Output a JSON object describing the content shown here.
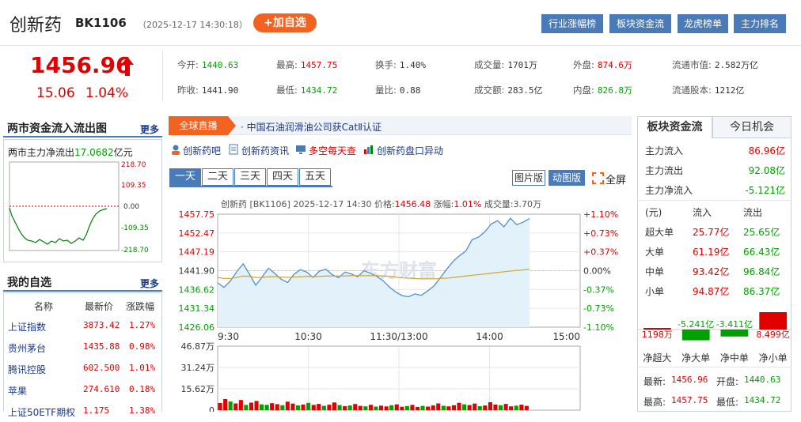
{
  "header": {
    "title": "创新药",
    "code": "BK1106",
    "datetime": "（2025-12-17 14:30:18）",
    "add_label": "+加自选",
    "nav": [
      "行业涨幅榜",
      "板块资金流",
      "龙虎榜单",
      "主力排名"
    ]
  },
  "quote": {
    "price": "1456.96",
    "change": "15.06",
    "change_pct": "1.04%",
    "items": [
      {
        "label": "今开:",
        "value": "1440.63",
        "color": "#00a000"
      },
      {
        "label": "最高:",
        "value": "1457.75",
        "color": "#e10000"
      },
      {
        "label": "换手:",
        "value": "1.40%",
        "color": "#333333"
      },
      {
        "label": "成交量:",
        "value": "1701万",
        "color": "#333333"
      },
      {
        "label": "外盘:",
        "value": "874.6万",
        "color": "#e10000"
      },
      {
        "label": "流通市值:",
        "value": "2.582万亿",
        "color": "#333333"
      },
      {
        "label": "昨收:",
        "value": "1441.90",
        "color": "#333333"
      },
      {
        "label": "最低:",
        "value": "1434.72",
        "color": "#00a000"
      },
      {
        "label": "量比:",
        "value": "0.88",
        "color": "#333333"
      },
      {
        "label": "成交额:",
        "value": "283.5亿",
        "color": "#333333"
      },
      {
        "label": "内盘:",
        "value": "826.8万",
        "color": "#00a000"
      },
      {
        "label": "流通股本:",
        "value": "1212亿",
        "color": "#333333"
      }
    ]
  },
  "flow_panel": {
    "title": "两市资金流入流出图",
    "more": "更多",
    "caption_prefix": "两市主力净流出",
    "caption_value": "17.0682",
    "caption_unit": "亿元",
    "ticks": [
      "218.70",
      "109.35",
      "0.00",
      "-109.35",
      "-218.70"
    ]
  },
  "watchlist": {
    "title": "我的自选",
    "more": "更多",
    "headers": [
      "名称",
      "最新价",
      "涨跌幅"
    ],
    "rows": [
      {
        "name": "上证指数",
        "price": "3873.42",
        "pct": "1.27%"
      },
      {
        "name": "贵州茅台",
        "price": "1435.88",
        "pct": "0.98%"
      },
      {
        "name": "腾讯控股",
        "price": "602.500",
        "pct": "1.01%"
      },
      {
        "name": "苹果",
        "price": "274.610",
        "pct": "0.18%"
      },
      {
        "name": "上证50ETF期权",
        "price": "1.175",
        "pct": "1.38%"
      }
    ]
  },
  "news": {
    "badge": "全球直播",
    "headline": "· 中国石油润滑油公司获CatⅡ认证"
  },
  "links": [
    "创新药吧",
    "创新药资讯",
    "多空每天查",
    "创新药盘口异动"
  ],
  "period_tabs": [
    "一天",
    "二天",
    "三天",
    "四天",
    "五天"
  ],
  "view_buttons": {
    "pic": "图片版",
    "dyn": "动图版",
    "full": "全屏"
  },
  "chart_info": {
    "name": "创新药 [BK1106]",
    "datetime": "2025-12-17 14:30",
    "price_label": "价格:",
    "price": "1456.48",
    "pct_label": "涨幅:",
    "pct": "1.01%",
    "vol_label": "成交量:",
    "vol": "3.70万",
    "watermark": "东方财富"
  },
  "chart_data": {
    "type": "line",
    "title": "创新药 [BK1106]",
    "y_ticks_left": [
      "1457.75",
      "1452.47",
      "1447.19",
      "1441.90",
      "1436.62",
      "1431.34",
      "1426.06"
    ],
    "y_ticks_right": [
      "+1.10%",
      "+0.73%",
      "+0.37%",
      "0.00%",
      "-0.37%",
      "-0.73%",
      "-1.10%"
    ],
    "x_ticks": [
      "9:30",
      "10:30",
      "11:30/13:00",
      "14:00",
      "15:00"
    ],
    "ylim": [
      1426.06,
      1457.75
    ],
    "base": 1441.9,
    "price_series": [
      1438.5,
      1437.2,
      1439.0,
      1441.6,
      1443.8,
      1440.9,
      1437.8,
      1440.2,
      1442.6,
      1441.1,
      1439.5,
      1438.6,
      1440.9,
      1442.2,
      1441.5,
      1440.0,
      1441.8,
      1442.3,
      1440.8,
      1439.9,
      1441.5,
      1441.0,
      1440.2,
      1441.9,
      1441.2,
      1440.3,
      1439.1,
      1437.3,
      1435.9,
      1434.9,
      1434.6,
      1435.4,
      1435.0,
      1436.2,
      1437.6,
      1439.9,
      1442.3,
      1444.5,
      1446.1,
      1447.4,
      1450.6,
      1451.3,
      1452.8,
      1455.0,
      1455.9,
      1454.2,
      1456.6,
      1454.8,
      1455.5,
      1456.5
    ],
    "avg_series": [
      1440.0,
      1439.7,
      1439.7,
      1440.0,
      1440.4,
      1440.3,
      1440.0,
      1440.0,
      1440.2,
      1440.2,
      1440.1,
      1440.0,
      1440.1,
      1440.2,
      1440.3,
      1440.2,
      1440.3,
      1440.4,
      1440.4,
      1440.4,
      1440.4,
      1440.5,
      1440.5,
      1440.5,
      1440.5,
      1440.5,
      1440.4,
      1440.3,
      1440.1,
      1439.9,
      1439.8,
      1439.7,
      1439.6,
      1439.6,
      1439.6,
      1439.7,
      1439.8,
      1440.0,
      1440.2,
      1440.4,
      1440.6,
      1440.8,
      1441.0,
      1441.2,
      1441.4,
      1441.6,
      1441.8,
      1442.0,
      1442.1,
      1442.3
    ],
    "volume_ticks": [
      "46.87万",
      "31.24万",
      "15.62万",
      "0"
    ],
    "volume_max": 46.87,
    "volume_series": [
      5.2,
      8.1,
      6.3,
      4.9,
      7.4,
      3.8,
      5.5,
      6.7,
      4.2,
      3.9,
      5.1,
      4.4,
      3.6,
      6.2,
      4.8,
      3.5,
      4.1,
      5.3,
      3.8,
      4.6,
      3.2,
      4.0,
      5.6,
      3.7,
      2.9,
      3.4,
      4.5,
      3.1,
      2.8,
      3.9,
      2.6,
      3.3,
      2.7,
      3.6,
      4.2,
      2.5,
      3.0,
      3.8,
      2.4,
      3.1,
      2.6,
      3.5,
      4.9,
      3.2,
      2.8,
      3.6,
      5.4,
      4.3,
      3.7,
      4.8,
      2.9,
      3.4,
      5.8,
      4.1,
      3.6,
      4.6,
      2.8,
      3.3,
      4.0,
      3.1
    ],
    "volume_colors": [
      "u",
      "u",
      "d",
      "u",
      "u",
      "d",
      "u",
      "u",
      "d",
      "d",
      "u",
      "u",
      "d",
      "u",
      "u",
      "d",
      "u",
      "d",
      "u",
      "u",
      "d",
      "u",
      "u",
      "d",
      "u",
      "d",
      "u",
      "u",
      "d",
      "u",
      "d",
      "u",
      "u",
      "d",
      "u",
      "u",
      "d",
      "u",
      "u",
      "d",
      "u",
      "u",
      "u",
      "d",
      "u",
      "u",
      "u",
      "d",
      "u",
      "u",
      "d",
      "u",
      "u",
      "u",
      "d",
      "u",
      "u",
      "d",
      "u",
      "u"
    ]
  },
  "right_panel": {
    "tabs": [
      "板块资金流",
      "今日机会"
    ],
    "summary": [
      {
        "label": "主力流入",
        "value": "86.96亿",
        "color": "#e10000"
      },
      {
        "label": "主力流出",
        "value": "92.08亿",
        "color": "#00a000"
      },
      {
        "label": "主力净流入",
        "value": "-5.121亿",
        "color": "#00a000"
      }
    ],
    "table_headers": [
      "(元)",
      "流入",
      "流出"
    ],
    "table_rows": [
      {
        "label": "超大单",
        "in": "25.77亿",
        "out": "25.65亿"
      },
      {
        "label": "大单",
        "in": "61.19亿",
        "out": "66.43亿"
      },
      {
        "label": "中单",
        "in": "93.42亿",
        "out": "96.84亿"
      },
      {
        "label": "小单",
        "in": "94.87亿",
        "out": "86.37亿"
      }
    ],
    "net_bars": [
      {
        "label": "净超大",
        "value": "1198万",
        "color": "#e10000"
      },
      {
        "label": "净大单",
        "value": "-5.241亿",
        "color": "#00a000"
      },
      {
        "label": "净中单",
        "value": "-3.411亿",
        "color": "#00a000"
      },
      {
        "label": "净小单",
        "value": "8.499亿",
        "color": "#e10000"
      }
    ],
    "bottom": [
      {
        "label": "最新:",
        "value": "1456.96",
        "color": "#e10000",
        "label2": "开盘:",
        "value2": "1440.63",
        "color2": "#00a000"
      },
      {
        "label": "最高:",
        "value": "1457.75",
        "color": "#e10000",
        "label2": "最低:",
        "value2": "1434.72",
        "color2": "#00a000"
      }
    ]
  }
}
